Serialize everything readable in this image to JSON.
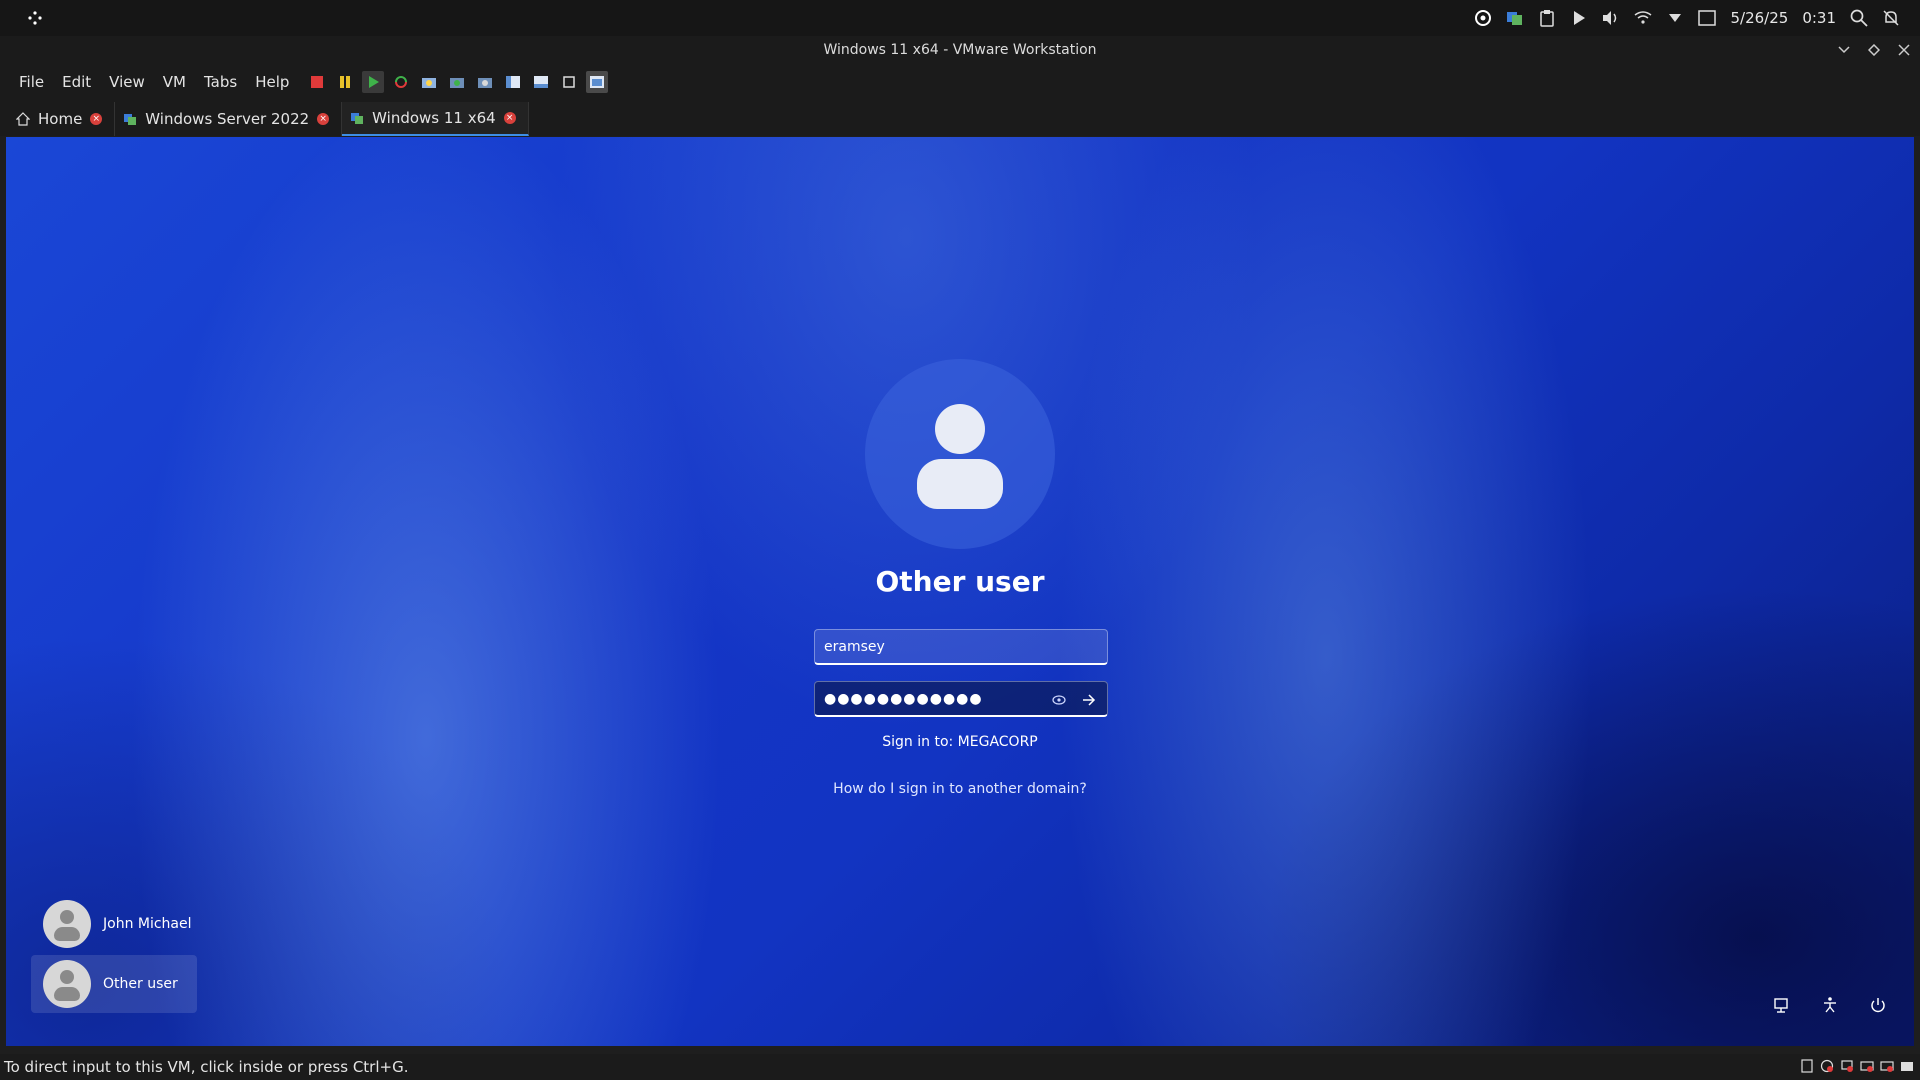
{
  "system_panel": {
    "date": "5/26/25",
    "time": "0:31"
  },
  "window": {
    "title": "Windows 11 x64 - VMware Workstation"
  },
  "menu": [
    "File",
    "Edit",
    "View",
    "VM",
    "Tabs",
    "Help"
  ],
  "tabs": [
    {
      "label": "Home"
    },
    {
      "label": "Windows Server 2022"
    },
    {
      "label": "Windows 11 x64"
    }
  ],
  "login": {
    "title": "Other user",
    "username_value": "eramsey",
    "password_value": "●●●●●●●●●●●●",
    "sign_in_to": "Sign in to: MEGACORP",
    "other_domain_link": "How do I sign in to another domain?"
  },
  "users": [
    {
      "name": "John Michael"
    },
    {
      "name": "Other user"
    }
  ],
  "status": {
    "message": "To direct input to this VM, click inside or press Ctrl+G."
  },
  "colors": {
    "accent": "#3d8ee6",
    "tab_close": "#d9413c",
    "wallpaper_base": "#1536c8"
  }
}
